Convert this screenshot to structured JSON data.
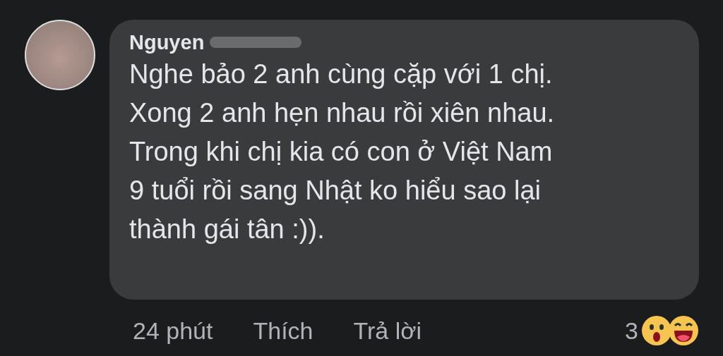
{
  "comment": {
    "author": "Nguyen",
    "text": "Nghe bảo 2 anh cùng cặp với 1 chị.\nXong 2 anh hẹn nhau rồi xiên nhau.\nTrong khi chị kia có con ở Việt Nam\n9 tuổi rồi sang Nhật ko hiểu sao lại\nthành gái tân :)).",
    "time": "24 phút",
    "actions": [
      "Thích",
      "Trả lời"
    ],
    "reactions": {
      "count": "3",
      "items": [
        {
          "kind": "wow"
        },
        {
          "kind": "haha"
        }
      ]
    }
  }
}
